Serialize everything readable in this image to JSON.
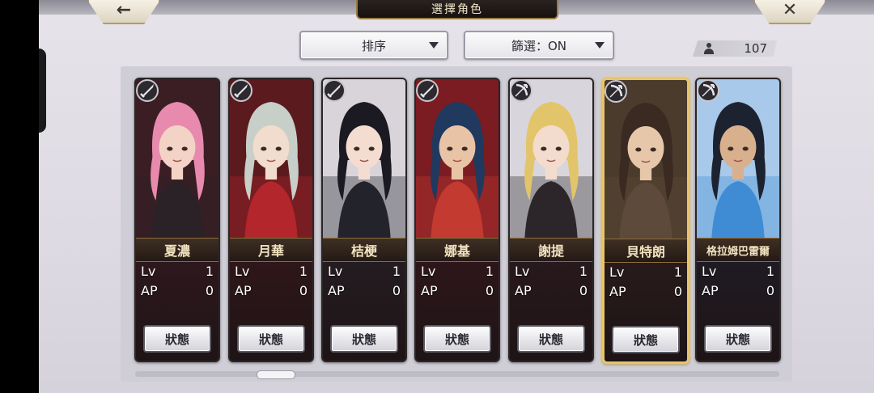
{
  "header": {
    "back_icon": "←",
    "close_icon": "✕",
    "title": "選擇角色"
  },
  "toolbar": {
    "sort_label": "排序",
    "filter_label": "篩選：ON",
    "owned_count": "107"
  },
  "colors": {
    "selected_border": "#e8c56a",
    "name_plate": "#2f231b",
    "panel_bg": "#cfcdd5"
  },
  "scroll": {
    "position_fraction": 0.2
  },
  "characters": [
    {
      "name": "夏濃",
      "lv_label": "Lv",
      "lv": "1",
      "ap_label": "AP",
      "ap": "0",
      "button": "狀態",
      "weapon_icon": "sword-icon",
      "selected": false,
      "palette": {
        "bg": "#3b1e24",
        "hair": "#e88aae",
        "cloth": "#2a2226",
        "skin": "#f3d3c5",
        "stat_bg": "#4a1e28"
      }
    },
    {
      "name": "月華",
      "lv_label": "Lv",
      "lv": "1",
      "ap_label": "AP",
      "ap": "0",
      "button": "狀態",
      "weapon_icon": "sword-icon",
      "selected": false,
      "palette": {
        "bg": "#5a1a1e",
        "hair": "#c8cfc8",
        "cloth": "#b3262b",
        "skin": "#f1dccd",
        "stat_bg": "#4d1a1f"
      }
    },
    {
      "name": "桔梗",
      "lv_label": "Lv",
      "lv": "1",
      "ap_label": "AP",
      "ap": "0",
      "button": "狀態",
      "weapon_icon": "sword-icon",
      "selected": false,
      "palette": {
        "bg": "#d8d4da",
        "hair": "#1b1a22",
        "cloth": "#23232b",
        "skin": "#f4ddd0",
        "stat_bg": "#2e2b33"
      }
    },
    {
      "name": "娜基",
      "lv_label": "Lv",
      "lv": "1",
      "ap_label": "AP",
      "ap": "0",
      "button": "狀態",
      "weapon_icon": "sword-icon",
      "selected": false,
      "palette": {
        "bg": "#7b1c22",
        "hair": "#20395e",
        "cloth": "#c23a30",
        "skin": "#e9c3a6",
        "stat_bg": "#4b1a1f"
      }
    },
    {
      "name": "謝提",
      "lv_label": "Lv",
      "lv": "1",
      "ap_label": "AP",
      "ap": "0",
      "button": "狀態",
      "weapon_icon": "bow-icon",
      "selected": false,
      "palette": {
        "bg": "#d8d6dc",
        "hair": "#e2c56a",
        "cloth": "#2c262b",
        "skin": "#f3dccd",
        "stat_bg": "#3a2226"
      }
    },
    {
      "name": "貝特朗",
      "lv_label": "Lv",
      "lv": "1",
      "ap_label": "AP",
      "ap": "0",
      "button": "狀態",
      "weapon_icon": "bow-icon",
      "selected": true,
      "palette": {
        "bg": "#4a3b2c",
        "hair": "#3a2a22",
        "cloth": "#5e4a3a",
        "skin": "#e6c7aa",
        "stat_bg": "#3a2724"
      }
    },
    {
      "name": "格拉姆巴雷爾",
      "lv_label": "Lv",
      "lv": "1",
      "ap_label": "AP",
      "ap": "0",
      "button": "狀態",
      "weapon_icon": "bow-icon",
      "selected": false,
      "palette": {
        "bg": "#a8c9ea",
        "hair": "#1d2230",
        "cloth": "#3f8bd4",
        "skin": "#d9b08e",
        "stat_bg": "#22283c"
      }
    }
  ]
}
